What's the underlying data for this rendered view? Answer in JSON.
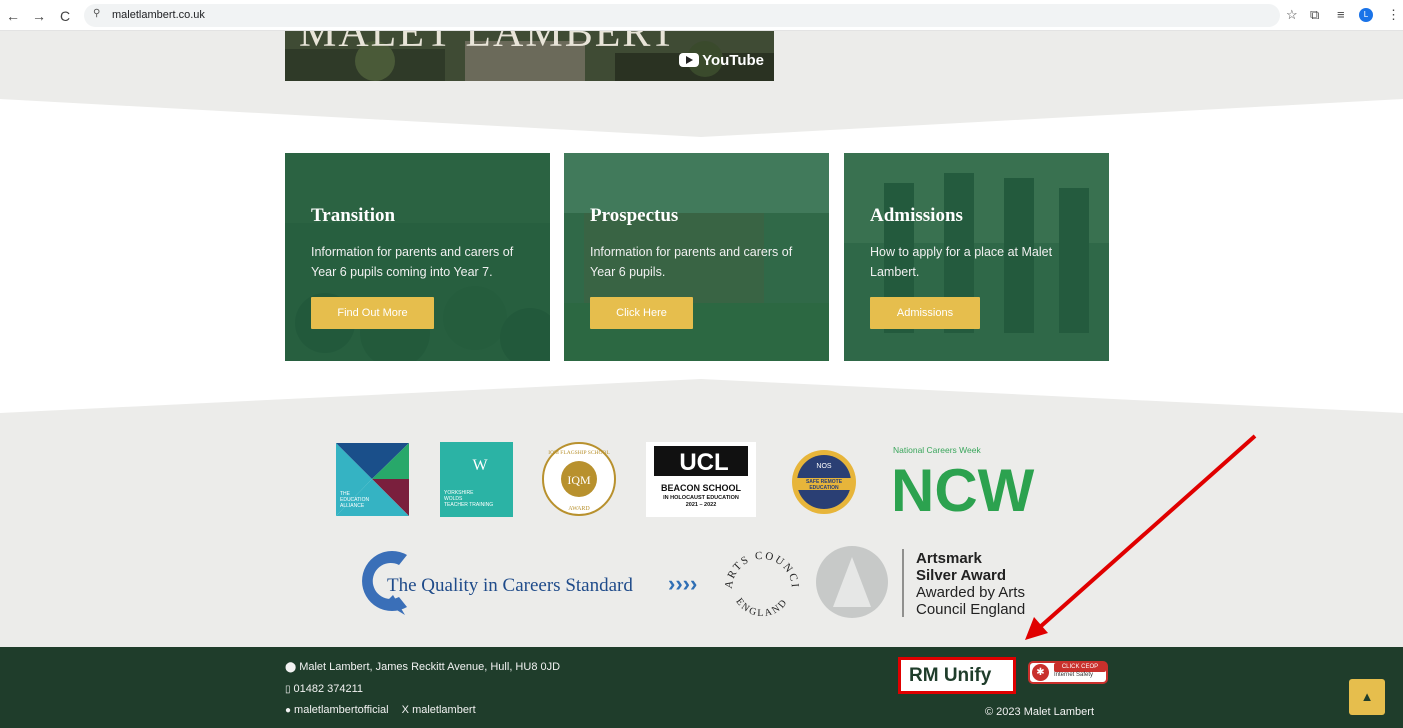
{
  "browser": {
    "url": "maletlambert.co.uk",
    "back_icon": "←",
    "forward_icon": "→",
    "reload_icon": "C",
    "site_icon": "⚲",
    "star_icon": "☆",
    "extensions_icon": "⧉",
    "media_icon": "≡",
    "profile_initial": "L",
    "menu_icon": "⋮"
  },
  "video": {
    "title_fragment": "MALET LAMBERT",
    "youtube_label": "YouTube"
  },
  "cards": [
    {
      "title": "Transition",
      "text": "Information for parents and carers of Year 6 pupils coming into Year 7.",
      "button": "Find Out More"
    },
    {
      "title": "Prospectus",
      "text": "Information for parents and carers of Year 6 pupils.",
      "button": "Click Here"
    },
    {
      "title": "Admissions",
      "text": "How to apply for a place at Malet Lambert.",
      "button": "Admissions"
    }
  ],
  "logos": {
    "education_alliance": [
      "THE",
      "EDUCATION",
      "ALLIANCE"
    ],
    "yorkshire_wolds": [
      "YORKSHIRE",
      "WOLDS",
      "TEACHER TRAINING"
    ],
    "iqm": {
      "center": "IQM",
      "top": "IQM FLAGSHIP SCHOOL",
      "bottom": "AWARD"
    },
    "ucl": {
      "mark": "UCL",
      "line1": "BEACON SCHOOL",
      "line2": "IN HOLOCAUST EDUCATION",
      "line3": "2021 – 2022"
    },
    "nos": {
      "top": "NOS",
      "line1": "SAFE REMOTE",
      "line2": "EDUCATION"
    },
    "ncw": {
      "top": "National Careers Week",
      "mark": "NCW"
    },
    "quality_careers": {
      "text": "The Quality in Careers Standard",
      "arrows": "››››"
    },
    "arts_council": {
      "top": "ARTS COUNCIL",
      "bottom": "ENGLAND"
    },
    "artsmark": {
      "line1": "Artsmark",
      "line2": "Silver Award",
      "line3": "Awarded by Arts",
      "line4": "Council England"
    }
  },
  "footer": {
    "address": "Malet Lambert, James Reckitt Avenue, Hull, HU8 0JD",
    "phone": "01482 374211",
    "facebook": "maletlambertofficial",
    "x_handle": "maletlambert",
    "x_icon": "X",
    "rm_unify": "RM Unify",
    "ceop_top": "CLICK CEOP",
    "ceop_bottom": "Internet Safety",
    "copyright": "© 2023 Malet Lambert",
    "scroll_up_icon": "▲"
  },
  "colors": {
    "card_overlay": "#266e48",
    "button_gold": "#e6be4d",
    "footer_green": "#1f3d2b",
    "annotation_red": "#e00000",
    "page_grey": "#ececea"
  }
}
